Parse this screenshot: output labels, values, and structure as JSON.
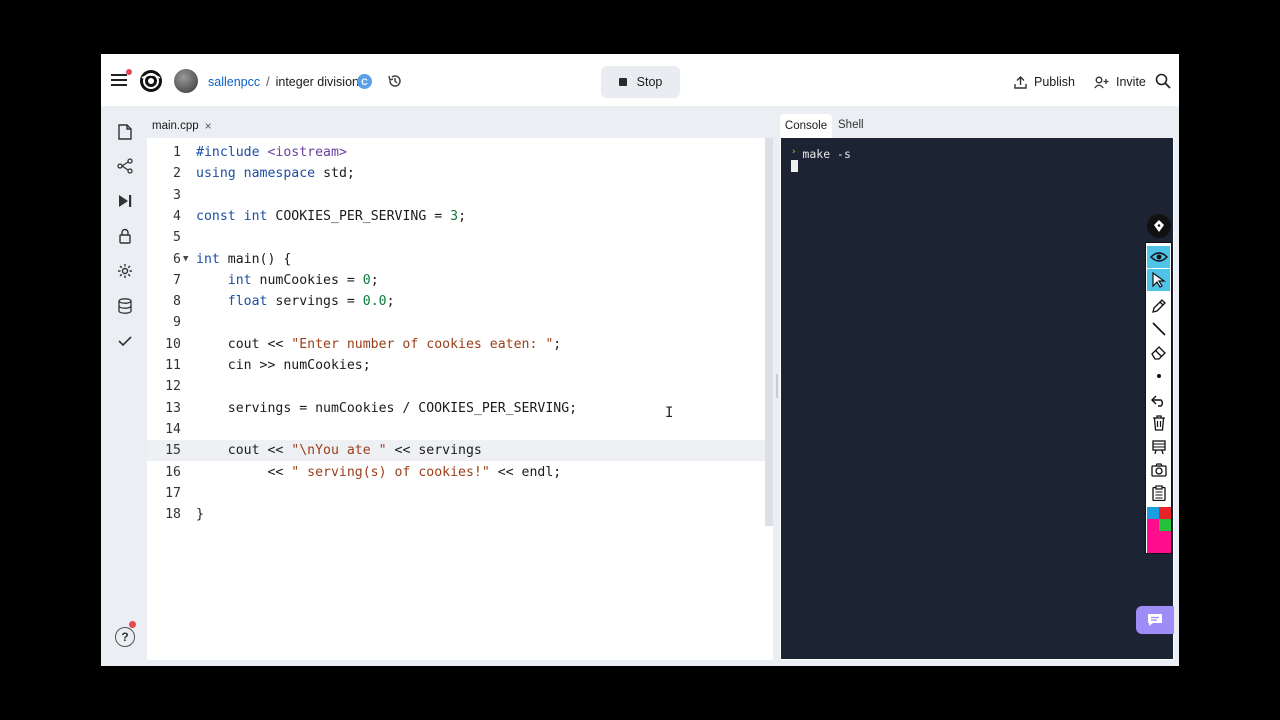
{
  "header": {
    "username": "sallenpcc",
    "separator": "/",
    "repl_name": "integer division",
    "lang_badge": "C",
    "stop_label": "Stop",
    "publish_label": "Publish",
    "invite_label": "Invite"
  },
  "rail": {
    "icons": [
      "file-icon",
      "git-branch-icon",
      "run-icon",
      "lock-icon",
      "gear-icon",
      "database-icon",
      "checkmark-icon"
    ],
    "help_label": "?"
  },
  "editor": {
    "tab_label": "main.cpp",
    "tab_close": "×",
    "active_line": 15,
    "lines": [
      {
        "n": "1",
        "text": "#include <iostream>"
      },
      {
        "n": "2",
        "text": "using namespace std;"
      },
      {
        "n": "3",
        "text": ""
      },
      {
        "n": "4",
        "text": "const int COOKIES_PER_SERVING = 3;"
      },
      {
        "n": "5",
        "text": ""
      },
      {
        "n": "6",
        "text": "int main() {"
      },
      {
        "n": "7",
        "text": "    int numCookies = 0;"
      },
      {
        "n": "8",
        "text": "    float servings = 0.0;"
      },
      {
        "n": "9",
        "text": ""
      },
      {
        "n": "10",
        "text": "    cout << \"Enter number of cookies eaten: \";"
      },
      {
        "n": "11",
        "text": "    cin >> numCookies;"
      },
      {
        "n": "12",
        "text": ""
      },
      {
        "n": "13",
        "text": "    servings = numCookies / COOKIES_PER_SERVING;"
      },
      {
        "n": "14",
        "text": ""
      },
      {
        "n": "15",
        "text": "    cout << \"\\nYou ate \" << servings"
      },
      {
        "n": "16",
        "text": "         << \" serving(s) of cookies!\" << endl;"
      },
      {
        "n": "17",
        "text": ""
      },
      {
        "n": "18",
        "text": "}"
      }
    ]
  },
  "console": {
    "tab_console": "Console",
    "tab_shell": "Shell",
    "prompt": "›",
    "command": "make -s"
  },
  "annotation_toolbar": {
    "tools": [
      "eye-icon",
      "pointer-icon",
      "pen-icon",
      "line-icon",
      "eraser-icon",
      "dot-icon",
      "undo-icon",
      "trash-icon",
      "board-icon",
      "camera-icon",
      "clipboard-icon"
    ],
    "selected_tools": [
      "eye-icon",
      "pointer-icon"
    ],
    "swatch_colors": [
      "#1a9fe0",
      "#e8232a",
      "#ff0d8c",
      "#22c33a"
    ],
    "active_color": "#ff0d8c"
  },
  "colors": {
    "accent_link": "#0f62c7",
    "console_bg": "#1c2333",
    "chat_button": "#9f8df7"
  }
}
